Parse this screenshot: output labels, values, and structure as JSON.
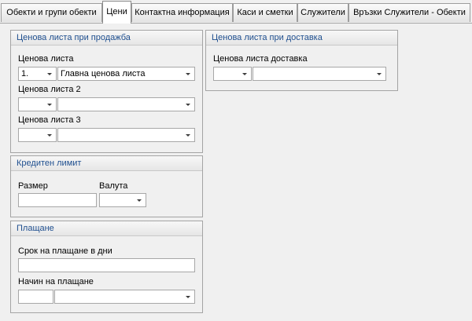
{
  "tabs": [
    {
      "label": "Обекти и групи обекти",
      "active": false
    },
    {
      "label": "Цени",
      "active": true
    },
    {
      "label": "Контактна информация",
      "active": false
    },
    {
      "label": "Каси и сметки",
      "active": false
    },
    {
      "label": "Служители",
      "active": false
    },
    {
      "label": "Връзки Служители - Обекти",
      "active": false
    }
  ],
  "sales_prices": {
    "title": "Ценова листа при продажба",
    "list1": {
      "label": "Ценова листа",
      "code": "1.",
      "name": "Главна ценова листа"
    },
    "list2": {
      "label": "Ценова листа 2",
      "code": "",
      "name": ""
    },
    "list3": {
      "label": "Ценова листа 3",
      "code": "",
      "name": ""
    }
  },
  "credit_limit": {
    "title": "Кредитен лимит",
    "size_label": "Размер",
    "size_value": "",
    "currency_label": "Валута",
    "currency_value": ""
  },
  "payment": {
    "title": "Плащане",
    "term_label": "Срок на плащане в дни",
    "term_value": "",
    "method_label": "Начин на плащане",
    "method_code": "",
    "method_name": ""
  },
  "delivery_prices": {
    "title": "Ценова листа при доставка",
    "list_label": "Ценова листа доставка",
    "code": "",
    "name": ""
  },
  "colors": {
    "panel_title": "#1f4f8f",
    "background": "#f0f0f0",
    "border": "#a4a4a4"
  }
}
